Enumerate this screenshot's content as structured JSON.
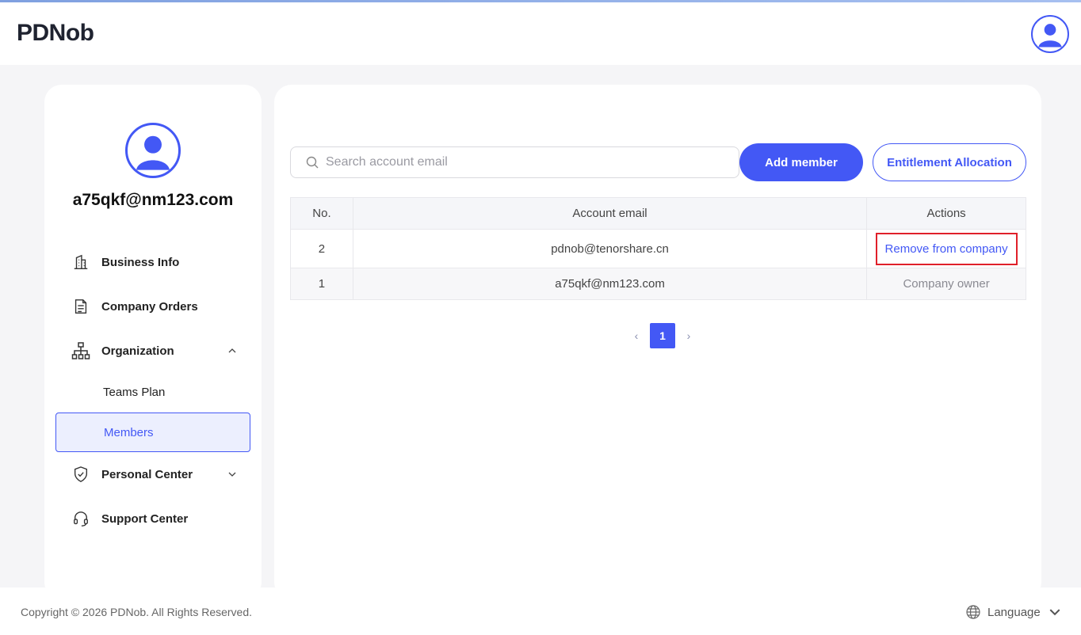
{
  "header": {
    "logo": "PDNob"
  },
  "sidebar": {
    "user_email": "a75qkf@nm123.com",
    "items": [
      {
        "label": "Business Info",
        "icon": "building-icon"
      },
      {
        "label": "Company Orders",
        "icon": "document-icon"
      },
      {
        "label": "Organization",
        "icon": "org-chart-icon",
        "expanded": true,
        "children": [
          {
            "label": "Teams Plan"
          },
          {
            "label": "Members",
            "active": true
          }
        ]
      },
      {
        "label": "Personal Center",
        "icon": "shield-icon",
        "expanded": false
      },
      {
        "label": "Support Center",
        "icon": "headset-icon"
      }
    ]
  },
  "main": {
    "search": {
      "placeholder": "Search account email",
      "value": ""
    },
    "add_member_label": "Add member",
    "entitlement_label": "Entitlement Allocation",
    "table": {
      "headers": [
        "No.",
        "Account email",
        "Actions"
      ],
      "rows": [
        {
          "no": "2",
          "email": "pdnob@tenorshare.cn",
          "action": "Remove from company"
        },
        {
          "no": "1",
          "email": "a75qkf@nm123.com",
          "action": "Company owner"
        }
      ]
    },
    "pagination": {
      "current": "1",
      "prev": "‹",
      "next": "›"
    }
  },
  "footer": {
    "copyright": "Copyright © 2026 PDNob. All Rights Reserved.",
    "language_label": "Language"
  },
  "colors": {
    "accent": "#4358f5",
    "highlight_border": "#e0202a"
  }
}
